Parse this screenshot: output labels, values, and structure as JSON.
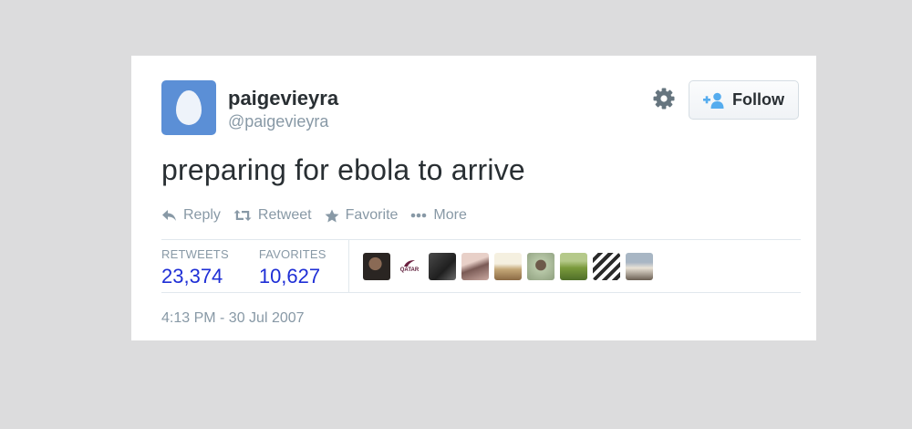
{
  "user": {
    "display_name": "paigevieyra",
    "screen_name": "@paigevieyra"
  },
  "header": {
    "follow_label": "Follow",
    "settings_icon": "gear-icon"
  },
  "tweet": {
    "text": "preparing for ebola to arrive",
    "timestamp": "4:13 PM - 30 Jul 2007"
  },
  "actions": [
    {
      "label": "Reply",
      "icon": "reply-icon"
    },
    {
      "label": "Retweet",
      "icon": "retweet-icon"
    },
    {
      "label": "Favorite",
      "icon": "star-icon"
    },
    {
      "label": "More",
      "icon": "more-icon"
    }
  ],
  "stats": {
    "retweets_label": "RETWEETS",
    "retweets_value": "23,374",
    "favorites_label": "FAVORITES",
    "favorites_value": "10,627"
  },
  "favoriters": {
    "logo_text": "QATAR"
  },
  "colors": {
    "link_blue": "#1f2fd6",
    "avatar_blue": "#5b8fd6",
    "muted_gray": "#8899a6",
    "text_dark": "#292f33"
  }
}
